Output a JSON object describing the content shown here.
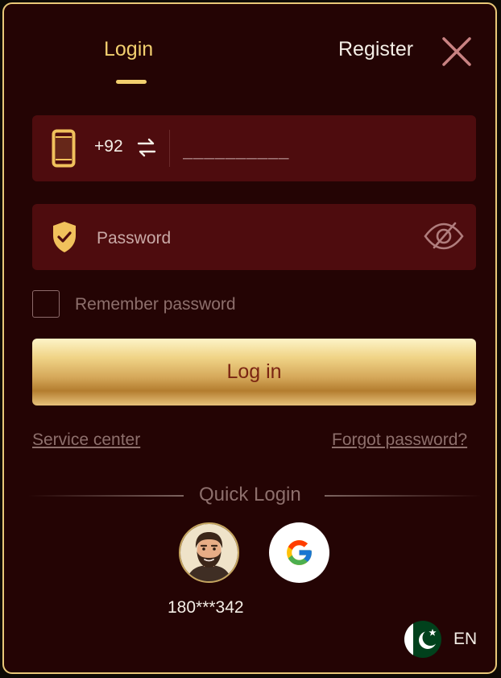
{
  "tabs": {
    "login": "Login",
    "register": "Register"
  },
  "phone": {
    "country_code": "+92",
    "placeholder": "__________"
  },
  "password": {
    "placeholder": "Password"
  },
  "remember": {
    "label": "Remember password",
    "checked": false
  },
  "login_button": "Log in",
  "links": {
    "service_center": "Service center",
    "forgot_password": "Forgot password?"
  },
  "quick_login": {
    "title": "Quick Login",
    "saved_account": "180***342",
    "options": [
      "saved-account-avatar",
      "google"
    ]
  },
  "language": {
    "code": "EN",
    "flag": "pakistan-flag-icon"
  },
  "colors": {
    "panel_bg": "#240404",
    "field_bg": "#4e0c0e",
    "accent_gold": "#f2cf6f",
    "border_gold": "#e9c878",
    "muted_text": "#8d6f6c"
  }
}
